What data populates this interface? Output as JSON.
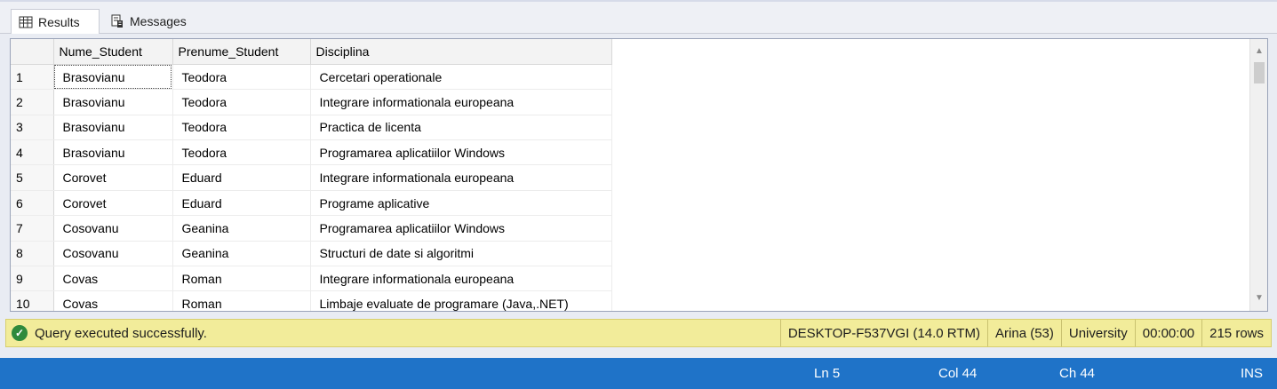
{
  "tabs": [
    {
      "label": "Results",
      "icon": "grid-icon"
    },
    {
      "label": "Messages",
      "icon": "messages-icon"
    }
  ],
  "grid": {
    "columns": [
      "",
      "Nume_Student",
      "Prenume_Student",
      "Disciplina"
    ],
    "rows": [
      [
        "1",
        "Brasovianu",
        "Teodora",
        "Cercetari operationale"
      ],
      [
        "2",
        "Brasovianu",
        "Teodora",
        "Integrare informationala europeana"
      ],
      [
        "3",
        "Brasovianu",
        "Teodora",
        "Practica de licenta"
      ],
      [
        "4",
        "Brasovianu",
        "Teodora",
        "Programarea aplicatiilor Windows"
      ],
      [
        "5",
        "Corovet",
        "Eduard",
        "Integrare informationala europeana"
      ],
      [
        "6",
        "Corovet",
        "Eduard",
        "Programe aplicative"
      ],
      [
        "7",
        "Cosovanu",
        "Geanina",
        "Programarea aplicatiilor Windows"
      ],
      [
        "8",
        "Cosovanu",
        "Geanina",
        "Structuri de date si algoritmi"
      ],
      [
        "9",
        "Covas",
        "Roman",
        "Integrare informationala europeana"
      ],
      [
        "10",
        "Covas",
        "Roman",
        "Limbaje evaluate de programare (Java,.NET)"
      ]
    ]
  },
  "status": {
    "message": "Query executed successfully.",
    "server": "DESKTOP-F537VGI (14.0 RTM)",
    "user": "Arina (53)",
    "database": "University",
    "elapsed": "00:00:00",
    "rows": "215 rows"
  },
  "editor_status": {
    "line": "Ln 5",
    "col": "Col 44",
    "ch": "Ch 44",
    "mode": "INS"
  },
  "colors": {
    "status_bg": "#f2ec9a",
    "success": "#2f8a3c",
    "bottom_bar": "#1f73c8"
  }
}
